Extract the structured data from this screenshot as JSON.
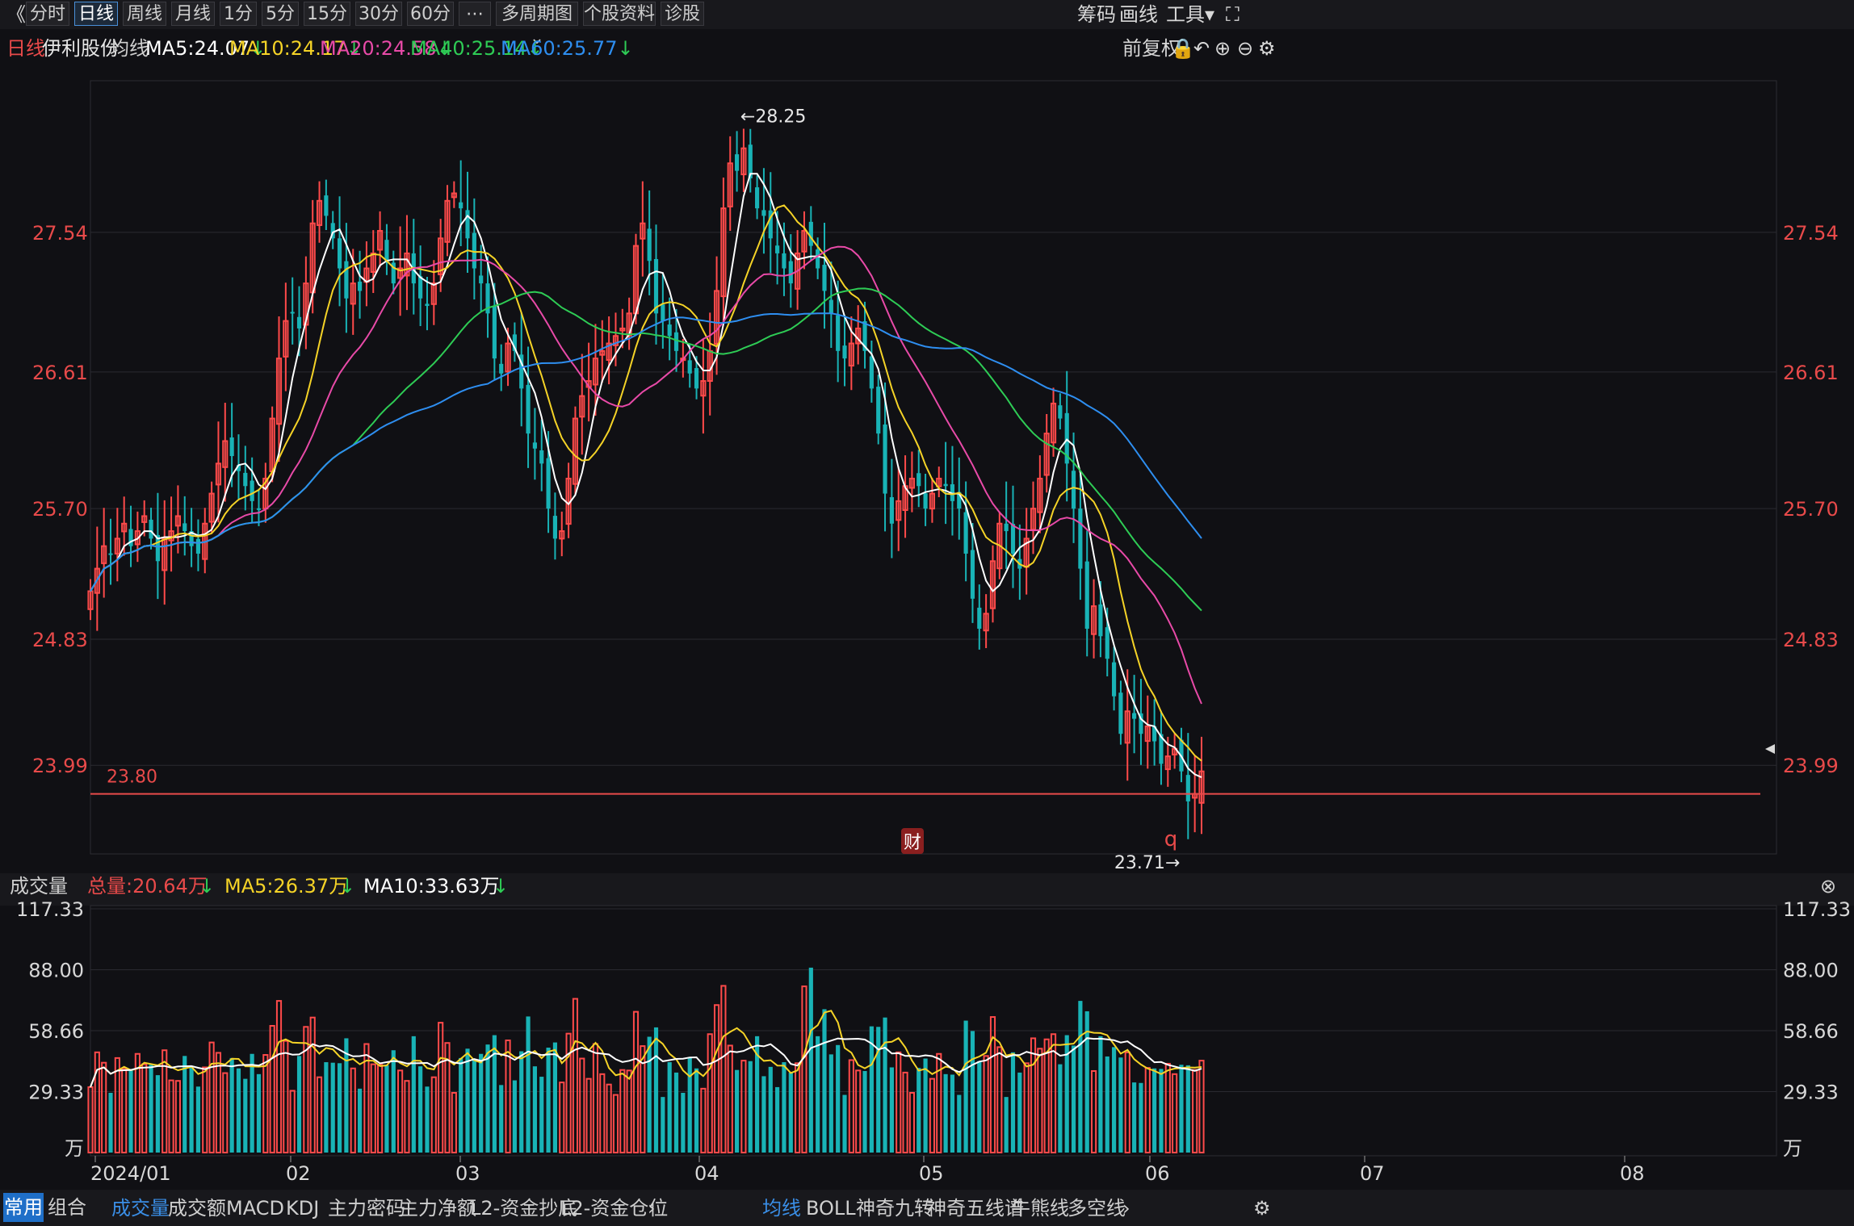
{
  "toolbar": {
    "back": "《",
    "periods": [
      "分时",
      "日线",
      "周线",
      "月线",
      "1分",
      "5分",
      "15分",
      "30分",
      "60分",
      "⋯",
      "多周期图",
      "个股资料",
      "诊股"
    ],
    "active_period": "日线",
    "right": [
      "筹码",
      "画线",
      "工具"
    ],
    "fullscreen_icon": "fullscreen-icon"
  },
  "ma_bar": {
    "period": "日线",
    "stock": "伊利股份",
    "ma_label": "均线",
    "ma5": "MA5:24.07",
    "ma10": "MA10:24.17",
    "ma20": "MA20:24.58",
    "ma40": "MA40:25.14",
    "ma60": "MA60:25.77",
    "adjust": "前复权",
    "colors": {
      "ma5": "#ffffff",
      "ma10": "#f5d327",
      "ma20": "#e84aa8",
      "ma40": "#2ecc55",
      "ma60": "#2e8ef0"
    }
  },
  "volume_bar": {
    "label": "成交量",
    "total": "总量:20.64万",
    "ma5": "MA5:26.37万",
    "ma10": "MA10:33.63万"
  },
  "chart_data": [
    {
      "type": "candlestick",
      "ylim": [
        23.4,
        28.55
      ],
      "yticks": [
        "27.54",
        "26.61",
        "25.70",
        "24.83",
        "23.99"
      ],
      "xticks": [
        "2024/01",
        "02",
        "03",
        "04",
        "05",
        "06",
        "07",
        "08"
      ],
      "annotations": {
        "high": "←28.25",
        "low": "23.71→",
        "support": "23.80",
        "support_value": 23.8,
        "event_fin": "财",
        "event_q": "q"
      },
      "series": [
        {
          "name": "MA5",
          "color": "#ffffff"
        },
        {
          "name": "MA10",
          "color": "#f5d327"
        },
        {
          "name": "MA20",
          "color": "#e84aa8"
        },
        {
          "name": "MA40",
          "color": "#2ecc55"
        },
        {
          "name": "MA60",
          "color": "#2e8ef0"
        }
      ],
      "up_color": "#ff4a4a",
      "down_color": "#19b3b6",
      "closes": [
        25.15,
        25.3,
        25.45,
        25.4,
        25.5,
        25.6,
        25.45,
        25.55,
        25.65,
        25.5,
        25.35,
        25.5,
        25.55,
        25.65,
        25.55,
        25.45,
        25.4,
        25.6,
        25.8,
        26.0,
        26.15,
        26.05,
        25.95,
        25.85,
        25.75,
        25.7,
        25.9,
        26.3,
        26.7,
        26.95,
        27.0,
        26.9,
        27.2,
        27.6,
        27.75,
        27.65,
        27.5,
        27.3,
        27.1,
        27.2,
        27.15,
        27.3,
        27.4,
        27.55,
        27.35,
        27.2,
        27.3,
        27.4,
        27.2,
        27.1,
        27.05,
        27.2,
        27.5,
        27.75,
        27.8,
        27.7,
        27.5,
        27.3,
        27.2,
        27.0,
        26.7,
        26.6,
        26.8,
        26.75,
        26.5,
        26.2,
        26.1,
        26.0,
        25.7,
        25.5,
        25.55,
        25.9,
        26.3,
        26.45,
        26.55,
        26.7,
        26.75,
        26.8,
        26.85,
        26.9,
        27.0,
        27.45,
        27.6,
        27.35,
        27.0,
        26.95,
        26.85,
        26.75,
        26.7,
        26.6,
        26.5,
        26.55,
        26.75,
        27.15,
        27.7,
        28.0,
        27.95,
        28.1,
        27.9,
        27.7,
        27.65,
        27.5,
        27.4,
        27.3,
        27.2,
        27.4,
        27.55,
        27.45,
        27.3,
        27.15,
        27.0,
        26.75,
        26.7,
        26.8,
        26.9,
        26.75,
        26.5,
        26.2,
        25.8,
        25.6,
        25.75,
        25.85,
        25.9,
        25.85,
        25.7,
        25.8,
        25.9,
        25.85,
        25.75,
        25.7,
        25.4,
        25.1,
        24.9,
        25.0,
        25.35,
        25.6,
        25.55,
        25.4,
        25.3,
        25.5,
        25.7,
        25.9,
        26.2,
        26.4,
        26.3,
        26.0,
        25.7,
        25.3,
        24.9,
        25.05,
        24.85,
        24.7,
        24.45,
        24.2,
        24.35,
        24.3,
        24.2,
        24.25,
        24.15,
        24.0,
        24.05,
        24.1,
        23.95,
        23.75,
        23.8,
        23.95
      ]
    },
    {
      "type": "bar",
      "ylim": [
        0,
        117.33
      ],
      "yticks": [
        "117.33",
        "88.00",
        "58.66",
        "29.33",
        "万"
      ],
      "series": [
        {
          "name": "MA5",
          "color": "#f5d327"
        },
        {
          "name": "MA10",
          "color": "#ffffff"
        }
      ]
    }
  ],
  "bottom_tabs": {
    "left": [
      "常用",
      "组合"
    ],
    "indicators": [
      "成交量",
      "成交额",
      "MACD",
      "KDJ",
      "主力密码",
      "主力净额",
      "L2-资金抄底",
      "L2-资金仓位"
    ],
    "overlays": [
      "均线",
      "BOLL",
      "神奇九转",
      "神奇五线谱",
      "牛熊线",
      "多空线"
    ]
  }
}
